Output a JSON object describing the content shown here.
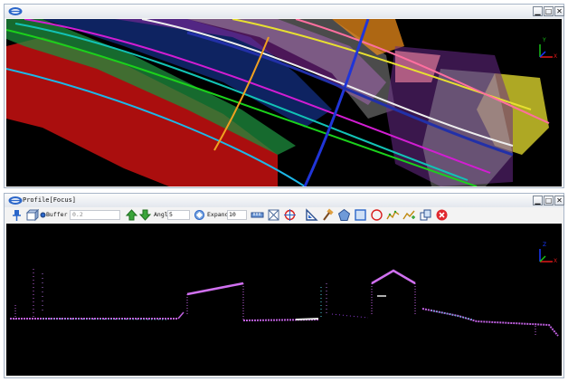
{
  "top_window": {
    "title": "",
    "buttons": {
      "minimize": "▁",
      "maximize": "□",
      "close": "✕"
    },
    "scene": "point-cloud-plan-view"
  },
  "bottom_window": {
    "title": "Profile[Focus]",
    "buttons": {
      "minimize": "▁",
      "maximize": "□",
      "close": "✕"
    },
    "toolbar": {
      "buffer": {
        "label": "Buffer",
        "value": "0.2"
      },
      "angle": {
        "label": "Angle",
        "value": "5"
      },
      "expand": {
        "label": "Expand",
        "value": "10"
      }
    },
    "scene": "point-cloud-profile-view"
  },
  "axis": {
    "x": "X",
    "y": "Y",
    "z": "Z"
  },
  "colors": {
    "viewport_bg": "#000000",
    "axis_x": "#e01818",
    "axis_y": "#18c018",
    "axis_z": "#1838ff",
    "accent_blue": "#2b66c9",
    "close_red": "#e0282f"
  },
  "icons": [
    "pin-icon",
    "layer-cube-icon",
    "arrow-up-icon",
    "arrow-down-icon",
    "rotate-icon",
    "measure-ruler-icon",
    "extent-icon",
    "target-icon",
    "triangle-ruler-icon",
    "hammer-icon",
    "polygon-icon",
    "rectangle-select-icon",
    "circle-icon",
    "polyline-icon",
    "line-add-icon",
    "export-icon",
    "close-red-icon"
  ]
}
